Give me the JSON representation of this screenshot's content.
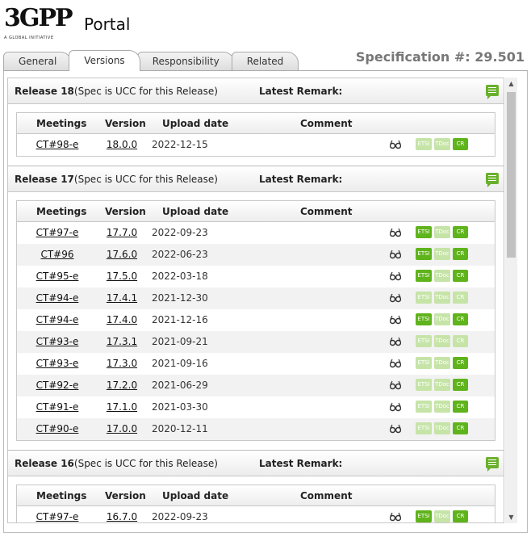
{
  "header": {
    "logo_mark": "3GPP",
    "logo_tagline": "A GLOBAL INITIATIVE",
    "portal_label": "Portal",
    "spec_title": "Specification #: 29.501"
  },
  "tabs": [
    {
      "label": "General",
      "active": false
    },
    {
      "label": "Versions",
      "active": true
    },
    {
      "label": "Responsibility",
      "active": false
    },
    {
      "label": "Related",
      "active": false
    }
  ],
  "columns": {
    "meetings": "Meetings",
    "version": "Version",
    "upload_date": "Upload date",
    "comment": "Comment"
  },
  "remark_label": "Latest Remark:",
  "badge_labels": {
    "etsi": "ETSI",
    "tdoc": "TDoc",
    "cr": "CR"
  },
  "colors": {
    "badge_on": "#5fb31b",
    "badge_off": "#c6e4a8",
    "spec_title": "#777777"
  },
  "releases": [
    {
      "title": "Release 18",
      "subtitle": "(Spec is UCC for this Release)",
      "rows": [
        {
          "meeting": "CT#98-e",
          "version": "18.0.0",
          "date": "2022-12-15",
          "etsi": false,
          "tdoc": false,
          "cr": true
        }
      ]
    },
    {
      "title": "Release 17",
      "subtitle": "(Spec is UCC for this Release)",
      "rows": [
        {
          "meeting": "CT#97-e",
          "version": "17.7.0",
          "date": "2022-09-23",
          "etsi": true,
          "tdoc": false,
          "cr": true
        },
        {
          "meeting": "CT#96",
          "version": "17.6.0",
          "date": "2022-06-23",
          "etsi": true,
          "tdoc": false,
          "cr": true
        },
        {
          "meeting": "CT#95-e",
          "version": "17.5.0",
          "date": "2022-03-18",
          "etsi": true,
          "tdoc": false,
          "cr": true
        },
        {
          "meeting": "CT#94-e",
          "version": "17.4.1",
          "date": "2021-12-30",
          "etsi": false,
          "tdoc": false,
          "cr": false
        },
        {
          "meeting": "CT#94-e",
          "version": "17.4.0",
          "date": "2021-12-16",
          "etsi": true,
          "tdoc": false,
          "cr": true
        },
        {
          "meeting": "CT#93-e",
          "version": "17.3.1",
          "date": "2021-09-21",
          "etsi": false,
          "tdoc": false,
          "cr": false
        },
        {
          "meeting": "CT#93-e",
          "version": "17.3.0",
          "date": "2021-09-16",
          "etsi": false,
          "tdoc": false,
          "cr": true
        },
        {
          "meeting": "CT#92-e",
          "version": "17.2.0",
          "date": "2021-06-29",
          "etsi": false,
          "tdoc": false,
          "cr": true
        },
        {
          "meeting": "CT#91-e",
          "version": "17.1.0",
          "date": "2021-03-30",
          "etsi": false,
          "tdoc": false,
          "cr": true
        },
        {
          "meeting": "CT#90-e",
          "version": "17.0.0",
          "date": "2020-12-11",
          "etsi": false,
          "tdoc": false,
          "cr": true
        }
      ]
    },
    {
      "title": "Release 16",
      "subtitle": "(Spec is UCC for this Release)",
      "rows": [
        {
          "meeting": "CT#97-e",
          "version": "16.7.0",
          "date": "2022-09-23",
          "etsi": true,
          "tdoc": false,
          "cr": true
        }
      ]
    }
  ]
}
